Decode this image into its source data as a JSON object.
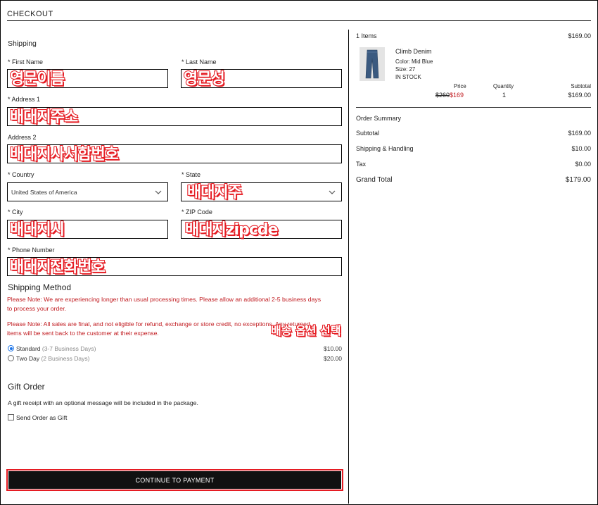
{
  "header": {
    "title": "CHECKOUT"
  },
  "shipping": {
    "section_title": "Shipping",
    "first_name": {
      "label": "* First Name",
      "annotation": "영문이름"
    },
    "last_name": {
      "label": "* Last Name",
      "annotation": "영문성"
    },
    "address1": {
      "label": "* Address 1",
      "annotation": "배대지주소"
    },
    "address2": {
      "label": "Address 2",
      "annotation": "배대지사서함번호"
    },
    "country": {
      "label": "* Country",
      "value": "United States of America"
    },
    "state": {
      "label": "* State",
      "annotation": "배대지주"
    },
    "city": {
      "label": "* City",
      "annotation": "배대지시"
    },
    "zip": {
      "label": "* ZIP Code",
      "annotation": "배대지zipcde"
    },
    "phone": {
      "label": "* Phone Number",
      "annotation": "배대지전화번호"
    }
  },
  "shipping_method": {
    "title": "Shipping Method",
    "note1_line1": "Please Note: We are experiencing longer than usual processing times. Please allow an additional 2-5 business days",
    "note1_line2": "to process your order.",
    "note2_line1": "Please Note: All sales are final, and not eligible for refund, exchange or store credit, no exceptions. Any returned",
    "note2_line2": "items will be sent back to the customer at their expense.",
    "annotation": "배송 옵션 선택",
    "options": [
      {
        "name": "Standard",
        "detail": "(3-7 Business Days)",
        "price": "$10.00",
        "selected": true
      },
      {
        "name": "Two Day",
        "detail": "(2 Business Days)",
        "price": "$20.00",
        "selected": false
      }
    ]
  },
  "gift": {
    "title": "Gift Order",
    "description": "A gift receipt with an optional message will be included in the package.",
    "checkbox_label": "Send Order as Gift"
  },
  "continue_button": "CONTINUE TO PAYMENT",
  "cart": {
    "items_count": "1 Items",
    "items_total": "$169.00",
    "item": {
      "name": "Climb Denim",
      "color": "Color: Mid Blue",
      "size": "Size: 27",
      "stock": "IN STOCK",
      "price_label": "Price",
      "original_price": "$260",
      "sale_price": "$169",
      "quantity_label": "Quantity",
      "quantity": "1",
      "subtotal_label": "Subtotal",
      "subtotal": "$169.00"
    }
  },
  "summary": {
    "title": "Order Summary",
    "subtotal_label": "Subtotal",
    "subtotal": "$169.00",
    "shipping_label": "Shipping & Handling",
    "shipping": "$10.00",
    "tax_label": "Tax",
    "tax": "$0.00",
    "grand_total_label": "Grand Total",
    "grand_total": "$179.00"
  },
  "colors": {
    "accent_red": "#e51c23",
    "note_red": "#c0191e",
    "button_bg": "#111111",
    "radio_blue": "#1a73e8"
  }
}
